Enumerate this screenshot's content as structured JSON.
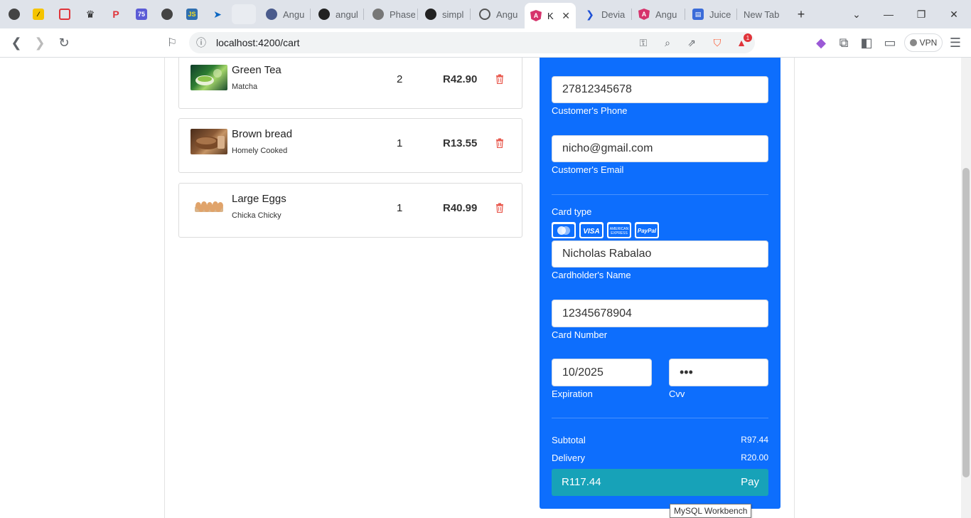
{
  "browser": {
    "tabs": [
      {
        "title": "",
        "fav": "globe-icon"
      },
      {
        "title": "",
        "fav": "yellow-app-icon"
      },
      {
        "title": "",
        "fav": "red-hexagon-icon"
      },
      {
        "title": "",
        "fav": "crown-icon"
      },
      {
        "title": "",
        "fav": "p-app-icon"
      },
      {
        "title": "",
        "fav": "75-app-icon"
      },
      {
        "title": "",
        "fav": "globe-icon"
      },
      {
        "title": "",
        "fav": "js-icon"
      },
      {
        "title": "",
        "fav": "azure-icon"
      },
      {
        "title": "",
        "fav": "blank-icon"
      },
      {
        "title": "Angu",
        "fav": "angular-globe-icon"
      },
      {
        "title": "angul",
        "fav": "github-icon"
      },
      {
        "title": "Phase",
        "fav": "github-gray-icon"
      },
      {
        "title": "simpl",
        "fav": "github-icon"
      },
      {
        "title": "Angu",
        "fav": "openai-icon"
      },
      {
        "title": "K",
        "fav": "angular-icon",
        "close": "✕"
      },
      {
        "title": "Devia",
        "fav": "deviant-icon"
      },
      {
        "title": "Angu",
        "fav": "angular-icon"
      },
      {
        "title": "Juice",
        "fav": "forms-icon"
      },
      {
        "title": "New Tab",
        "fav": ""
      }
    ],
    "new_tab": "+",
    "url": "localhost:4200/cart",
    "vpn_label": "VPN",
    "notif_count": "1"
  },
  "cart": {
    "items": [
      {
        "name": "Green Tea",
        "sub": "Matcha",
        "qty": "2",
        "price": "R42.90"
      },
      {
        "name": "Brown bread",
        "sub": "Homely Cooked",
        "qty": "1",
        "price": "R13.55"
      },
      {
        "name": "Large Eggs",
        "sub": "Chicka Chicky",
        "qty": "1",
        "price": "R40.99"
      }
    ]
  },
  "checkout": {
    "phone": {
      "value": "27812345678",
      "label": "Customer's Phone"
    },
    "email": {
      "value": "nicho@gmail.com",
      "label": "Customer's Email"
    },
    "card_type_label": "Card type",
    "cards": [
      {
        "name": "MasterCard",
        "color": "#0d6efd"
      },
      {
        "name": "VISA",
        "color": "#0d6efd"
      },
      {
        "name": "AMERICAN EXPRESS",
        "color": "#0d6efd"
      },
      {
        "name": "PayPal",
        "color": "#0d6efd"
      }
    ],
    "holder": {
      "value": "Nicholas Rabalao",
      "label": "Cardholder's Name"
    },
    "number": {
      "value": "12345678904",
      "label": "Card Number"
    },
    "expiry": {
      "value": "10/2025",
      "label": "Expiration"
    },
    "cvv": {
      "value": "•••",
      "label": "Cvv"
    },
    "subtotal": {
      "label": "Subtotal",
      "value": "R97.44"
    },
    "delivery": {
      "label": "Delivery",
      "value": "R20.00"
    },
    "pay": {
      "amount": "R117.44",
      "label": "Pay"
    }
  },
  "tooltip": "MySQL Workbench",
  "colors": {
    "panel": "#0d6efd",
    "pay_button": "#17a2b8",
    "trash": "#e8574c"
  }
}
